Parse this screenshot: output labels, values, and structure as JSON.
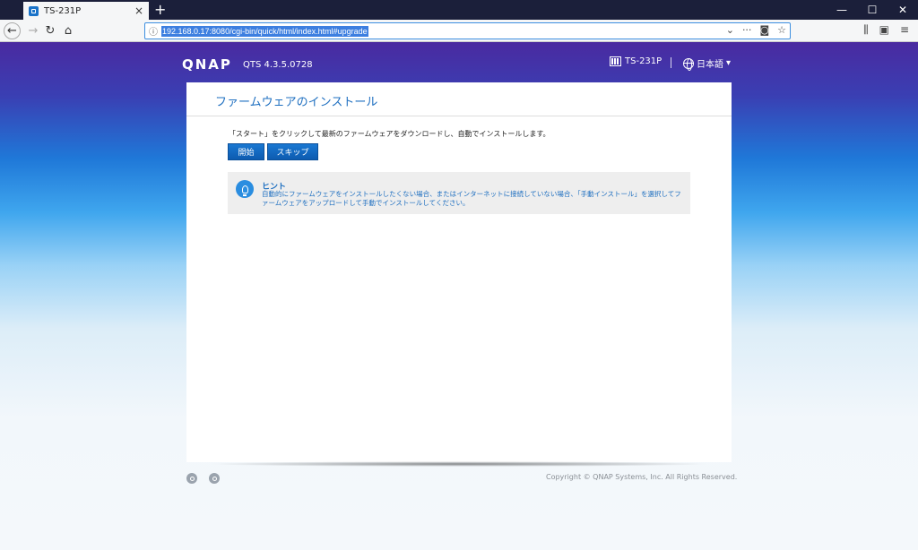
{
  "browser": {
    "tab_title": "TS-231P",
    "tab_close": "×",
    "new_tab": "+",
    "window": {
      "minimize": "—",
      "maximize": "☐",
      "close": "✕"
    },
    "url": "192.168.0.17:8080/cgi-bin/quick/html/index.html#upgrade",
    "nav": {
      "back": "←",
      "forward": "→",
      "reload": "↻",
      "home": "⌂",
      "info": "ⓘ"
    },
    "url_actions": {
      "dropdown": "⌄",
      "more": "···",
      "pocket": "◙",
      "bookmark": "☆"
    },
    "right_icons": {
      "library": "⫼",
      "sidebar": "▣",
      "menu": "≡"
    }
  },
  "header": {
    "logo": "QNAP",
    "version": "QTS 4.3.5.0728",
    "device_name": "TS-231P",
    "language": "日本語",
    "language_arrow": "▾"
  },
  "panel": {
    "title": "ファームウェアのインストール",
    "description": "「スタート」をクリックして最新のファームウェアをダウンロードし、自動でインストールします。",
    "start_button": "開始",
    "skip_button": "スキップ",
    "hint_title": "ヒント",
    "hint_body": "自動的にファームウェアをインストールしたくない場合、またはインターネットに接続していない場合、「手動インストール」を選択してファームウェアをアップロードして手動でインストールしてください。"
  },
  "footer": {
    "copyright": "Copyright © QNAP Systems, Inc. All Rights Reserved."
  },
  "colors": {
    "accent": "#1e6fc0",
    "button": "#0d5bb0",
    "header_top": "#4a2aa0"
  }
}
